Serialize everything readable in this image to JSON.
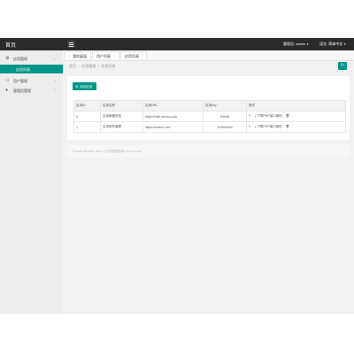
{
  "header": {
    "logo": "首页",
    "admin_label": "管理员: admin",
    "language_label": "语言: 简体中文"
  },
  "sidebar": {
    "items": [
      {
        "label": "应用管理",
        "icon": "gear-icon",
        "expanded": true
      },
      {
        "label": "用户管理",
        "icon": "users-icon",
        "expanded": false
      },
      {
        "label": "管理员管理",
        "icon": "user-icon",
        "expanded": false
      }
    ],
    "active_subitem": "应用列表"
  },
  "tabs": [
    {
      "label": "我的桌面",
      "icon": "home-icon",
      "closable": false
    },
    {
      "label": "用户列表",
      "closable": true
    },
    {
      "label": "应用列表",
      "closable": true
    }
  ],
  "breadcrumb": [
    "首页",
    "应用管理",
    "应用列表"
  ],
  "actions": {
    "add_app": "添加应用"
  },
  "table": {
    "columns": [
      "应用ID",
      "应用名称",
      "应用URL",
      "应用key",
      "操作"
    ],
    "rows": [
      {
        "id": "5",
        "name": "应用邮箱系统",
        "url": "https://mail.xxxxxx.com",
        "key": "54646",
        "download": "下载PHP接口案例"
      },
      {
        "id": "1",
        "name": "应用软件管理",
        "url": "https://xxxxxx.com",
        "key": "123564644",
        "download": "下载PHP接口案例"
      }
    ]
  },
  "footer": {
    "text": "Fumao Member Sai 1.0 应用管理系统 xxxxxx.com"
  },
  "colors": {
    "accent": "#009688",
    "topbar": "#2a2a2a",
    "sidebar": "#ededed"
  }
}
